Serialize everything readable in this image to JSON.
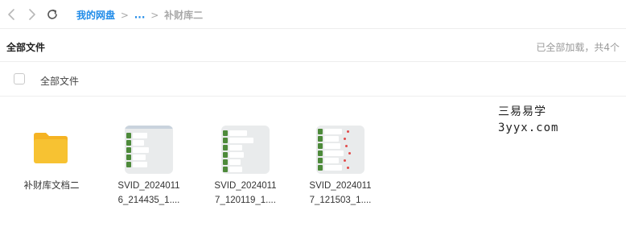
{
  "breadcrumb": {
    "root": "我的网盘",
    "sep": ">",
    "ellipsis": "...",
    "current": "补财库二"
  },
  "header": {
    "title": "全部文件",
    "status": "已全部加载，共4个"
  },
  "select_bar": {
    "label": "全部文件"
  },
  "files": [
    {
      "name": "补财库文档二",
      "type": "folder"
    },
    {
      "name_line1": "SVID_2024011",
      "name_line2": "6_214435_1....",
      "type": "video"
    },
    {
      "name_line1": "SVID_2024011",
      "name_line2": "7_120119_1....",
      "type": "video"
    },
    {
      "name_line1": "SVID_2024011",
      "name_line2": "7_121503_1....",
      "type": "video"
    }
  ],
  "watermark": {
    "line1": "三易易学",
    "line2": "3yyx.com"
  },
  "colors": {
    "accent": "#1f8be8",
    "folder": "#f7c232",
    "folder_tab": "#f5b323"
  }
}
